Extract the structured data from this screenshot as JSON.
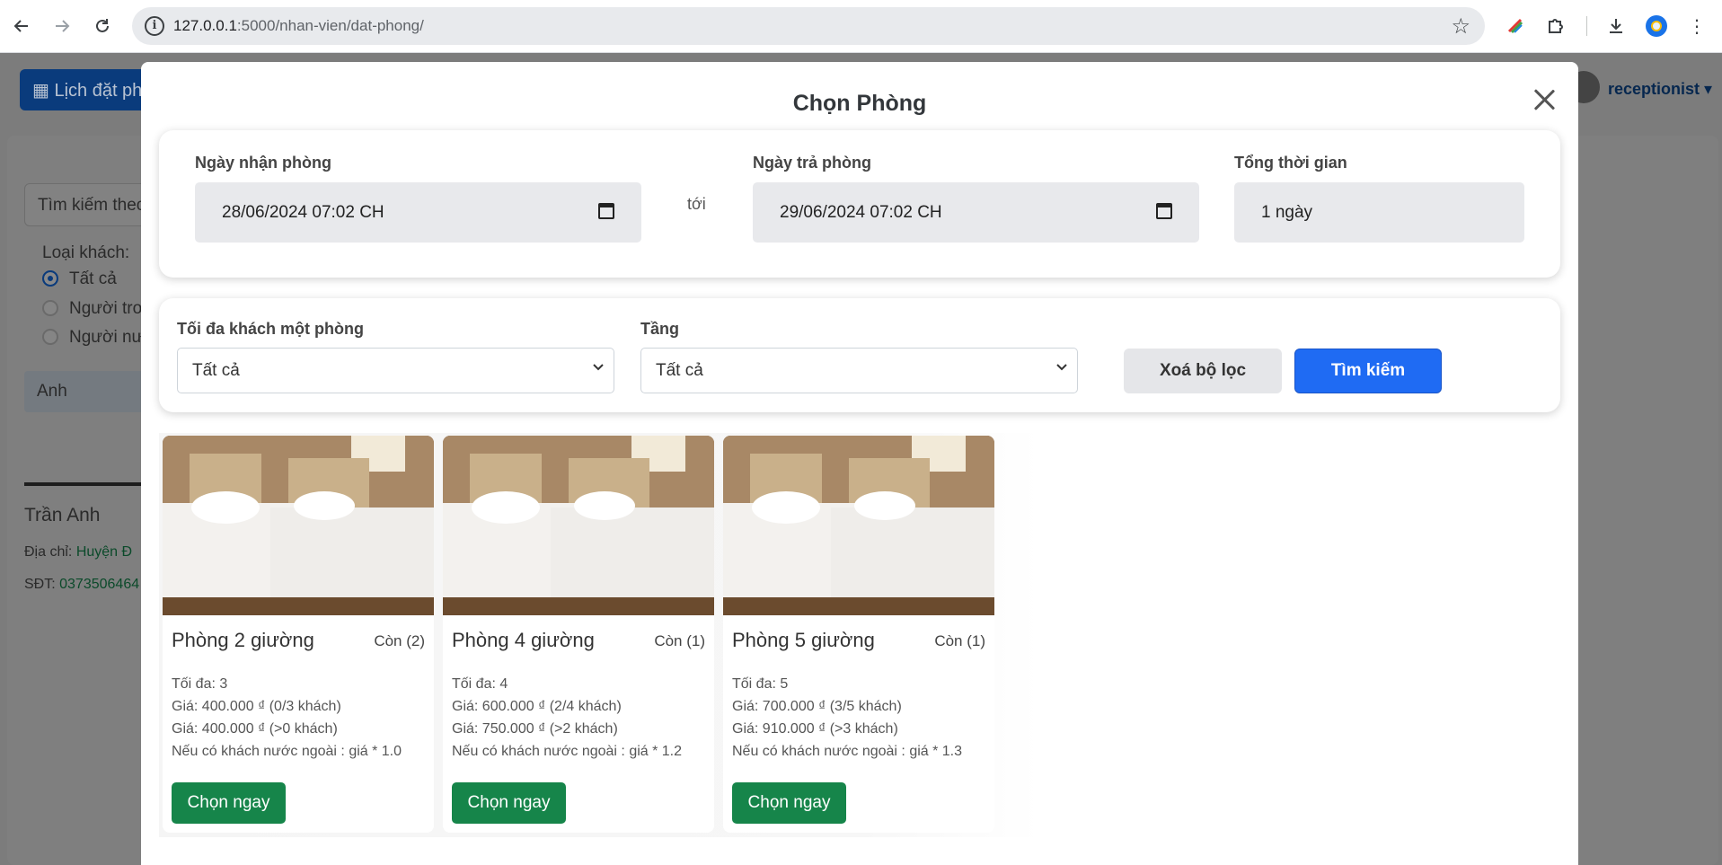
{
  "browser": {
    "url_host": "127.0.0.1",
    "url_path": ":5000/nhan-vien/dat-phong/"
  },
  "background": {
    "calendar_button": "Lịch đặt phòng",
    "user_name": "receptionist",
    "search_placeholder": "Tìm kiếm theo",
    "guest_type_label": "Loại khách:",
    "guest_types": [
      "Tất cả",
      "Người trong nước",
      "Người nước ngoài"
    ],
    "name_input": "Anh",
    "customer_name": "Trần Anh",
    "address_label": "Địa chỉ:",
    "address_value": "Huyện Đ",
    "phone_label": "SĐT:",
    "phone_value": "0373506464"
  },
  "modal": {
    "title": "Chọn Phòng",
    "checkin_label": "Ngày nhận phòng",
    "checkin_value": "28/06/2024 07:02  CH",
    "to_label": "tới",
    "checkout_label": "Ngày trả phòng",
    "checkout_value": "29/06/2024 07:02  CH",
    "duration_label": "Tổng thời gian",
    "duration_value": "1 ngày",
    "max_guests_label": "Tối đa khách một phòng",
    "max_guests_value": "Tất cả",
    "floor_label": "Tầng",
    "floor_value": "Tất cả",
    "clear_button": "Xoá bộ lọc",
    "search_button": "Tìm kiếm"
  },
  "rooms": [
    {
      "name": "Phòng 2 giường",
      "available": "Còn (2)",
      "max": "Tối đa: 3",
      "price1": "Giá: 400.000 ₫ (0/3 khách)",
      "price2": "Giá: 400.000 ₫ (>0 khách)",
      "foreign": "Nếu có khách nước ngoài : giá * 1.0",
      "button": "Chọn ngay"
    },
    {
      "name": "Phòng 4 giường",
      "available": "Còn (1)",
      "max": "Tối đa: 4",
      "price1": "Giá: 600.000 ₫ (2/4 khách)",
      "price2": "Giá: 750.000 ₫ (>2 khách)",
      "foreign": "Nếu có khách nước ngoài : giá * 1.2",
      "button": "Chọn ngay"
    },
    {
      "name": "Phòng 5 giường",
      "available": "Còn (1)",
      "max": "Tối đa: 5",
      "price1": "Giá: 700.000 ₫ (3/5 khách)",
      "price2": "Giá: 910.000 ₫ (>3 khách)",
      "foreign": "Nếu có khách nước ngoài : giá * 1.3",
      "button": "Chọn ngay"
    }
  ],
  "colors": {
    "primary": "#1f6bf3",
    "success": "#16854a"
  }
}
